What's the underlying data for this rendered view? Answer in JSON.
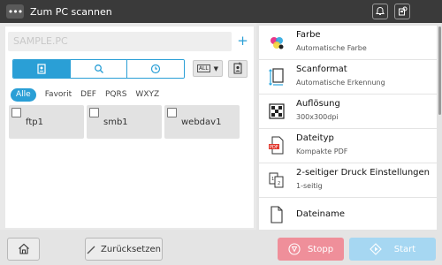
{
  "app": {
    "title": "Zum PC scannen",
    "menu_label": "•••"
  },
  "colors": {
    "accent": "#2a9fd6",
    "topbar": "#3a3a3a",
    "stop": "#ef8f9a",
    "start": "#a6d7f2"
  },
  "destination": {
    "address_placeholder": "SAMPLE.PC",
    "add_label": "+",
    "search_tabs": [
      {
        "icon": "address-book-icon",
        "active": true
      },
      {
        "icon": "search-icon",
        "active": false
      },
      {
        "icon": "clock-icon",
        "active": false
      }
    ],
    "filter_dropdown_label": "ALL",
    "index_tabs": [
      "Alle",
      "Favorit",
      "DEF",
      "PQRS",
      "WXYZ"
    ],
    "active_index_tab": "Alle",
    "items": [
      "ftp1",
      "smb1",
      "webdav1"
    ]
  },
  "settings": [
    {
      "icon": "color-icon",
      "title": "Farbe",
      "value": "Automatische Farbe"
    },
    {
      "icon": "scan-size-icon",
      "title": "Scanformat",
      "value": "Automatische Erkennung"
    },
    {
      "icon": "resolution-icon",
      "title": "Auflösung",
      "value": "300x300dpi"
    },
    {
      "icon": "pdf-file-icon",
      "title": "Dateityp",
      "value": "Kompakte PDF"
    },
    {
      "icon": "duplex-icon",
      "title": "2-seitiger Druck Einstellungen",
      "value": "1-seitig"
    },
    {
      "icon": "document-icon",
      "title": "Dateiname",
      "value": ""
    }
  ],
  "bottom": {
    "reset_label": "Zurücksetzen",
    "stop_label": "Stopp",
    "start_label": "Start"
  }
}
